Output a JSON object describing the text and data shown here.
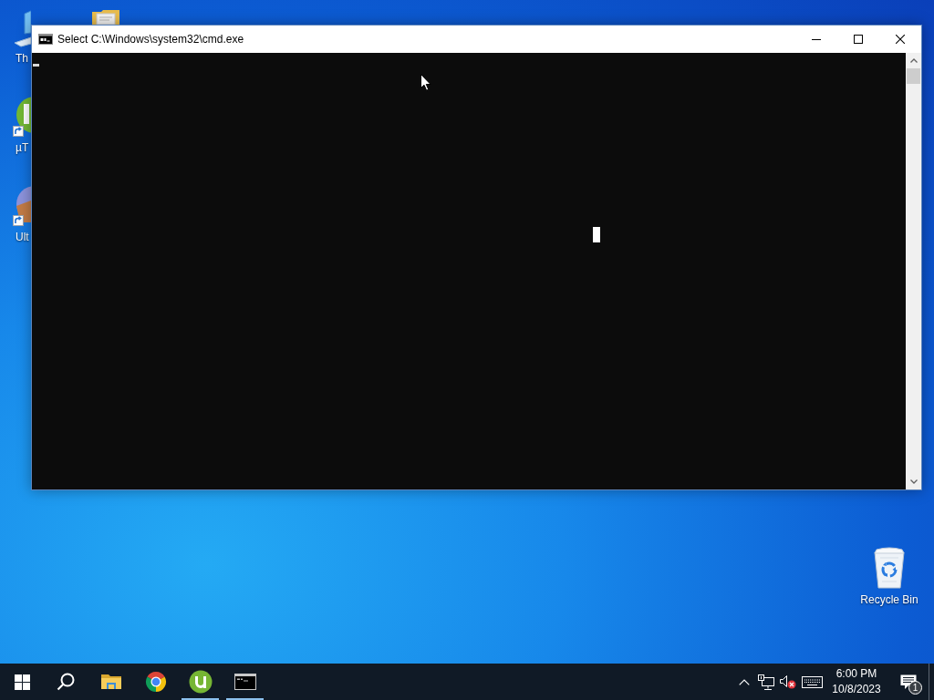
{
  "desktop": {
    "left_icons": [
      {
        "kind": "computer",
        "label": "Th"
      },
      {
        "kind": "torrent-shortcut",
        "label": "µT"
      },
      {
        "kind": "disc-shortcut",
        "label": "Ult"
      }
    ],
    "recycle_bin": {
      "label": "Recycle Bin"
    }
  },
  "window": {
    "title": "Select C:\\Windows\\system32\\cmd.exe"
  },
  "taskbar": {
    "apps": [
      {
        "kind": "file-explorer",
        "running": false
      },
      {
        "kind": "browser",
        "running": false
      },
      {
        "kind": "torrent",
        "running": true
      },
      {
        "kind": "terminal",
        "running": true
      }
    ],
    "tray": {
      "volume_muted": true,
      "time": "6:00 PM",
      "date": "10/8/2023",
      "notification_count": "1"
    }
  }
}
